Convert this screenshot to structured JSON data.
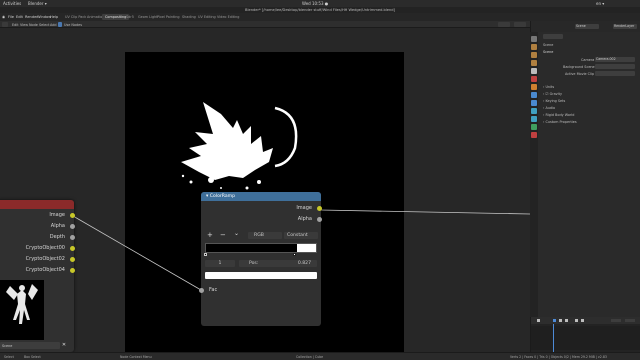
{
  "os_bar": {
    "activities": "Activities",
    "app": "Blender ▾",
    "clock": "Wed 10:53 ●",
    "lang": "en ▾"
  },
  "window": {
    "title": "Blender* [/home/lee/Desktop/blender stuff/Wind Files/HH Wedge/Untrimmed.blend]"
  },
  "menu": [
    "File",
    "Edit",
    "Render",
    "Window",
    "Help"
  ],
  "workspaces": [
    "UV Clip Pack",
    "Animation",
    "Compositing",
    "Sdr5",
    "Geom Light",
    "Pixel Painting",
    "Shading",
    "UV Editing",
    "Video Editing"
  ],
  "active_workspace": "Compositing",
  "node_header": {
    "items": [
      "Edit",
      "View",
      "Node",
      "Select",
      "Add",
      "Use Nodes"
    ]
  },
  "colorramp": {
    "title": "ColorRamp",
    "outputs": [
      "Image",
      "Alpha"
    ],
    "color_mode": "RGB",
    "interp": "Constant",
    "index": "1",
    "pos_label": "Pos:",
    "pos_value": "0.827",
    "input": "Fac",
    "add_btn": "+",
    "remove_btn": "−",
    "more_btn": "⌄"
  },
  "render_node": {
    "outputs": [
      "Image",
      "Alpha",
      "Depth",
      "CryptoObject00",
      "CryptoObject02",
      "CryptoObject04"
    ],
    "footer_label": "Scene"
  },
  "outliner": {
    "scene_label": "Scene",
    "layer_label": "RenderLayer"
  },
  "properties": {
    "breadcrumb": "Scene",
    "camera_label": "Camera",
    "camera_value": "Camera.002",
    "bg_label": "Background Scene",
    "clip_label": "Active Movie Clip",
    "sections": [
      "Units",
      "Gravity",
      "Keying Sets",
      "Audio",
      "Rigid Body World",
      "Custom Properties"
    ]
  },
  "status": {
    "select": "Select",
    "box_select": "Box Select",
    "node_context": "Node Context Menu",
    "scene_stats": "Collection | Cube",
    "version": "Verts 2 | Faces 0 | Tris 0 | Objects 0/2 | Mem 29.2 MiB | v2.83"
  },
  "colors": {
    "converter_header": "#3f6f9a",
    "input_header": "#8b2a2a",
    "socket_color": "#c7c729",
    "socket_float": "#a1a1a1",
    "active_tab": "#3d3d3d",
    "timeline_cursor": "#4d8ad6"
  }
}
